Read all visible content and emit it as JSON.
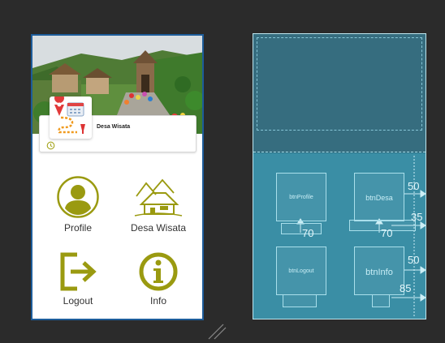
{
  "card": {
    "title": "Desa Wisata"
  },
  "menu": {
    "profile": "Profile",
    "desa": "Desa Wisata",
    "logout": "Logout",
    "info": "Info"
  },
  "blueprint": {
    "btn_profile": "btnProfile",
    "btn_desa": "btnDesa",
    "btn_logout": "btnLogout",
    "btn_info": "btnInfo",
    "margins": {
      "desa_right": "50",
      "profile_bottom": "70",
      "desa_text_right": "35",
      "desa_bottom": "70",
      "info_right": "50",
      "info_bottom": "85"
    }
  },
  "colors": {
    "icon_olive": "#9a9a10",
    "blueprint_bg": "#2d7388",
    "design_border": "#1d5c9a"
  }
}
